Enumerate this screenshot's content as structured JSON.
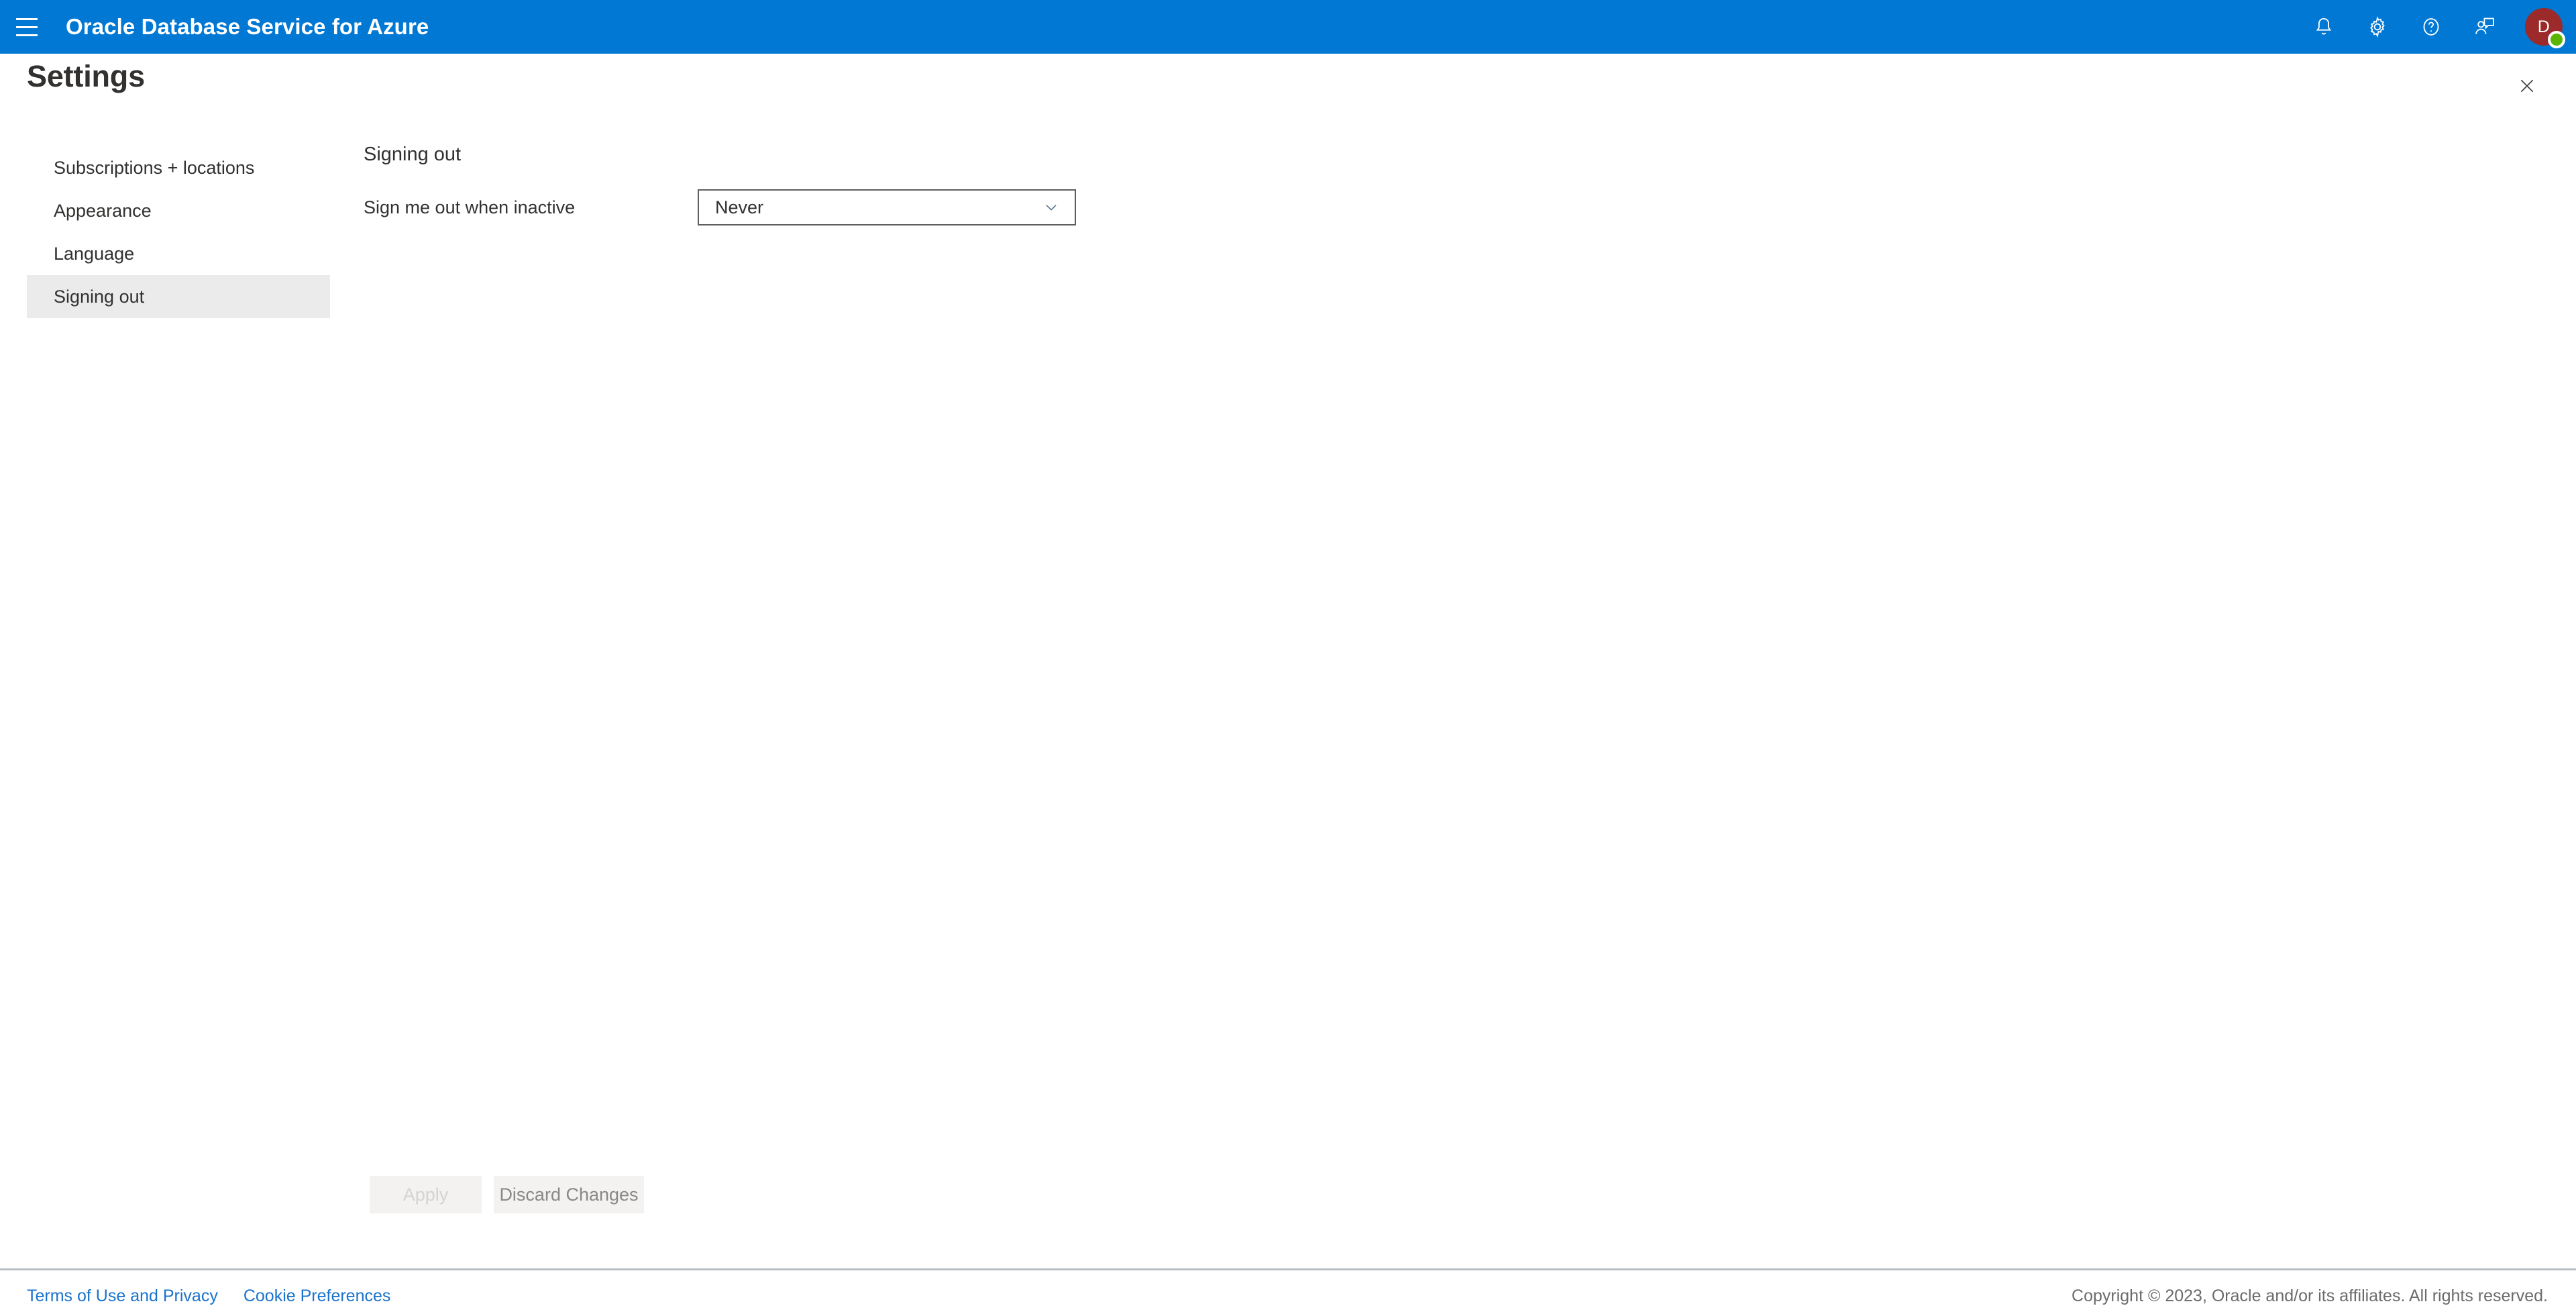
{
  "appbar": {
    "menu_icon": "hamburger-menu-icon",
    "title": "Oracle Database Service for Azure",
    "actions": [
      {
        "name": "notifications-button",
        "icon": "bell-icon"
      },
      {
        "name": "settings-button",
        "icon": "gear-icon"
      },
      {
        "name": "help-button",
        "icon": "question-circle-icon"
      },
      {
        "name": "feedback-button",
        "icon": "person-feedback-icon"
      }
    ],
    "avatar": {
      "initial": "D",
      "bg_color": "#9c2a2a",
      "presence_color": "#5cb300"
    },
    "bg_color": "#0078d4"
  },
  "panel": {
    "title": "Settings",
    "close_icon": "close-icon"
  },
  "sidebar": {
    "items": [
      {
        "label": "Subscriptions + locations",
        "selected": false
      },
      {
        "label": "Appearance",
        "selected": false
      },
      {
        "label": "Language",
        "selected": false
      },
      {
        "label": "Signing out",
        "selected": true
      }
    ],
    "selected_bg": "#ebebeb"
  },
  "main": {
    "section_heading": "Signing out",
    "field": {
      "label": "Sign me out when inactive",
      "dropdown": {
        "value": "Never",
        "caret_icon": "chevron-down-icon"
      }
    }
  },
  "actions": {
    "apply_label": "Apply",
    "apply_disabled": true,
    "discard_label": "Discard Changes"
  },
  "footer": {
    "links": [
      {
        "label": "Terms of Use and Privacy"
      },
      {
        "label": "Cookie Preferences"
      }
    ],
    "copyright": "Copyright © 2023, Oracle and/or its affiliates. All rights reserved.",
    "link_color": "#1a73cc"
  }
}
